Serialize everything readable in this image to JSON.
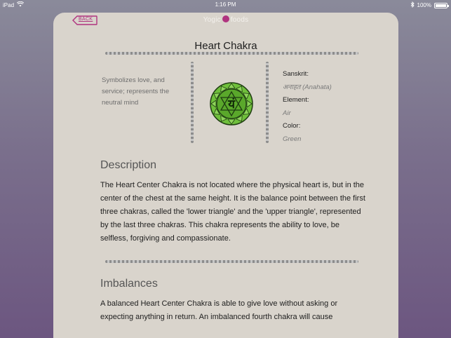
{
  "status_bar": {
    "device": "iPad",
    "time": "1:16 PM",
    "battery": "100%"
  },
  "nav": {
    "back_label": "BACK",
    "app_title_left": "Yog",
    "app_title_mid": "ic",
    "app_title_right": "foods"
  },
  "page": {
    "title": "Heart Chakra"
  },
  "overview": {
    "summary": "Symbolizes love, and service; represents the neutral mind",
    "sanskrit_label": "Sanskrit:",
    "sanskrit_value": "अनाहत (Anahata)",
    "element_label": "Element:",
    "element_value": "Air",
    "color_label": "Color:",
    "color_value": "Green",
    "symbol_glyph": "यं"
  },
  "description": {
    "heading": "Description",
    "text": "The Heart Center Chakra is not located where the physical heart is, but in the center of the chest at the same height. It is the balance point between the first three chakras, called the 'lower triangle' and the 'upper triangle', represented by the last three chakras. This chakra represents the ability to love, be selfless, forgiving and compassionate."
  },
  "imbalances": {
    "heading": "Imbalances",
    "text": "A balanced Heart Center Chakra is able to give love without asking or expecting anything in return. An imbalanced fourth chakra will cause"
  },
  "colors": {
    "accent": "#b0337f",
    "card_bg": "#d9d4cc",
    "chakra_green": "#6fbf3b",
    "chakra_dark": "#1f3d12"
  },
  "icons": [
    "wifi-icon",
    "bluetooth-icon",
    "battery-icon",
    "back-arrow-icon",
    "lotus-icon",
    "heart-chakra-symbol"
  ]
}
